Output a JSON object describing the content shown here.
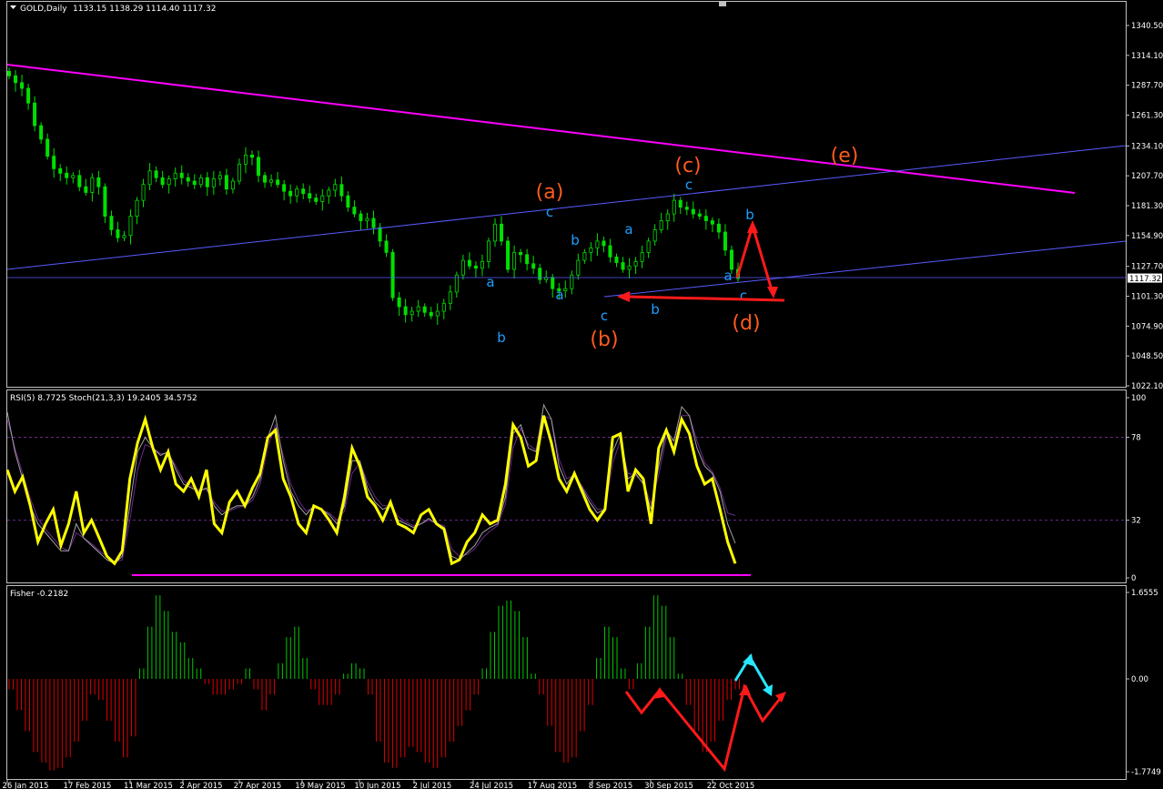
{
  "header": {
    "symbol": "GOLD,Daily",
    "ohlc": "1133.15 1138.29 1114.40 1117.32"
  },
  "colors": {
    "background": "#000000",
    "frame": "#c0c0c0",
    "candle": "#00e000",
    "magenta": "#ff00ff",
    "channel": "#5a5aff",
    "wave_blue": "#1e9fff",
    "wave_orange": "#ff5a1e",
    "arrow_red": "#ff1a1a",
    "rsi": "#ffff00",
    "stoch": "#b030b0",
    "fisher_pos": "#00c800",
    "fisher_neg": "#e00000",
    "cyan": "#28e6ff"
  },
  "price_axis": {
    "ticks": [
      "1340.50",
      "1314.10",
      "1287.70",
      "1261.30",
      "1234.10",
      "1207.70",
      "1181.30",
      "1154.90",
      "1127.70",
      "1101.30",
      "1074.90",
      "1048.50",
      "1022.10"
    ],
    "current": "1117.32"
  },
  "osc_panel": {
    "label": "RSI(5) 8.7725  Stoch(21,3,3) 19.2405 34.5752",
    "ticks": [
      "100",
      "78",
      "32",
      "0"
    ]
  },
  "fisher_panel": {
    "label": "Fisher -0.2182",
    "ticks": [
      "1.6555",
      "0.00",
      "-1.7749"
    ]
  },
  "date_axis": [
    "26 Jan 2015",
    "17 Feb 2015",
    "11 Mar 2015",
    "2 Apr 2015",
    "27 Apr 2015",
    "19 May 2015",
    "10 Jun 2015",
    "2 Jul 2015",
    "24 Jul 2015",
    "17 Aug 2015",
    "8 Sep 2015",
    "30 Sep 2015",
    "22 Oct 2015"
  ],
  "wave_labels": {
    "blue": [
      "a",
      "b",
      "c",
      "a",
      "b",
      "c",
      "a",
      "b",
      "c",
      "a",
      "b",
      "c"
    ],
    "orange": [
      "(a)",
      "(b)",
      "(c)",
      "(d)",
      "(e)"
    ]
  },
  "chart_data": [
    {
      "type": "candlestick",
      "title": "GOLD,Daily",
      "ylim": [
        1022.1,
        1352
      ],
      "close_series_approx": [
        1296,
        1290,
        1285,
        1272,
        1252,
        1240,
        1225,
        1214,
        1210,
        1206,
        1208,
        1198,
        1193,
        1206,
        1198,
        1172,
        1160,
        1153,
        1155,
        1172,
        1186,
        1200,
        1212,
        1206,
        1200,
        1205,
        1210,
        1206,
        1203,
        1200,
        1206,
        1198,
        1205,
        1208,
        1196,
        1203,
        1218,
        1226,
        1224,
        1208,
        1202,
        1204,
        1200,
        1194,
        1190,
        1196,
        1192,
        1188,
        1185,
        1190,
        1195,
        1200,
        1190,
        1180,
        1174,
        1168,
        1170,
        1162,
        1150,
        1140,
        1100,
        1092,
        1085,
        1088,
        1092,
        1087,
        1084,
        1088,
        1095,
        1105,
        1120,
        1133,
        1128,
        1126,
        1132,
        1150,
        1165,
        1150,
        1125,
        1140,
        1138,
        1130,
        1126,
        1116,
        1118,
        1108,
        1106,
        1108,
        1120,
        1133,
        1140,
        1144,
        1150,
        1146,
        1136,
        1131,
        1125,
        1128,
        1132,
        1140,
        1150,
        1160,
        1168,
        1174,
        1186,
        1180,
        1178,
        1174,
        1172,
        1168,
        1165,
        1158,
        1142,
        1125,
        1117
      ],
      "trendlines": {
        "magenta": {
          "from": [
            "26 Jan 2015",
            1308
          ],
          "to": [
            "6 Nov 2015",
            1198
          ]
        },
        "upper_channel": {
          "from": [
            "26 Jan 2015",
            1142
          ],
          "to": [
            "end",
            1235
          ]
        },
        "lower_channel": {
          "from": [
            "8 Sep 2015",
            1104
          ],
          "to": [
            "end",
            1154
          ]
        },
        "horizontal": 1117.32
      }
    },
    {
      "type": "line",
      "title": "RSI(5) 8.7725  Stoch(21,3,3) 19.2405 34.5752",
      "ylim": [
        0,
        100
      ],
      "levels": [
        78,
        32
      ],
      "series": [
        {
          "name": "RSI(5)",
          "values": [
            60,
            48,
            56,
            40,
            20,
            30,
            38,
            18,
            30,
            48,
            25,
            32,
            22,
            12,
            8,
            15,
            55,
            75,
            88,
            72,
            60,
            70,
            52,
            48,
            55,
            45,
            60,
            30,
            25,
            42,
            48,
            40,
            50,
            58,
            78,
            82,
            55,
            45,
            30,
            25,
            40,
            38,
            32,
            25,
            45,
            72,
            62,
            45,
            40,
            32,
            42,
            30,
            28,
            25,
            35,
            38,
            30,
            27,
            8,
            10,
            20,
            25,
            35,
            30,
            32,
            52,
            85,
            78,
            62,
            65,
            90,
            75,
            55,
            48,
            58,
            48,
            38,
            32,
            38,
            78,
            80,
            48,
            60,
            55,
            30,
            72,
            82,
            70,
            88,
            80,
            62,
            52,
            55,
            38,
            20,
            8
          ]
        },
        {
          "name": "Stoch %K",
          "values": [
            92,
            70,
            55,
            40,
            30,
            25,
            20,
            15,
            15,
            30,
            22,
            18,
            14,
            10,
            8,
            12,
            40,
            70,
            78,
            72,
            68,
            70,
            60,
            52,
            50,
            48,
            50,
            40,
            35,
            38,
            40,
            40,
            45,
            55,
            78,
            90,
            65,
            48,
            40,
            35,
            40,
            38,
            35,
            30,
            40,
            65,
            65,
            50,
            42,
            38,
            40,
            32,
            30,
            28,
            30,
            33,
            30,
            28,
            12,
            10,
            14,
            18,
            25,
            28,
            30,
            45,
            80,
            85,
            72,
            70,
            96,
            88,
            62,
            52,
            58,
            50,
            42,
            36,
            38,
            70,
            80,
            55,
            58,
            52,
            38,
            62,
            82,
            76,
            95,
            90,
            72,
            62,
            58,
            48,
            30,
            19.2
          ]
        },
        {
          "name": "Stoch %D",
          "values": [
            88,
            72,
            58,
            44,
            33,
            27,
            22,
            17,
            15,
            25,
            22,
            19,
            15,
            12,
            9,
            10,
            32,
            60,
            74,
            72,
            69,
            69,
            62,
            54,
            51,
            49,
            49,
            42,
            37,
            37,
            39,
            40,
            43,
            52,
            73,
            85,
            68,
            52,
            43,
            37,
            39,
            38,
            36,
            32,
            37,
            58,
            64,
            53,
            45,
            40,
            40,
            34,
            31,
            29,
            30,
            32,
            30,
            29,
            16,
            12,
            13,
            16,
            22,
            26,
            29,
            41,
            72,
            83,
            74,
            71,
            90,
            88,
            66,
            55,
            57,
            51,
            44,
            38,
            38,
            64,
            76,
            58,
            57,
            53,
            41,
            57,
            78,
            76,
            90,
            90,
            76,
            64,
            59,
            50,
            36,
            34.6
          ]
        }
      ],
      "horizontal_line": 10
    },
    {
      "type": "bar",
      "title": "Fisher -0.2182",
      "ylim": [
        -1.7749,
        1.6555
      ],
      "values": [
        -0.2,
        -0.6,
        -1.0,
        -1.4,
        -1.6,
        -1.75,
        -1.7,
        -1.5,
        -1.2,
        -0.8,
        -0.3,
        -0.4,
        -0.8,
        -1.2,
        -1.5,
        -1.1,
        0.2,
        1.0,
        1.6,
        1.3,
        0.9,
        0.7,
        0.4,
        0.2,
        -0.1,
        -0.3,
        -0.3,
        -0.2,
        -0.1,
        0.2,
        -0.2,
        -0.6,
        -0.3,
        0.3,
        0.8,
        1.0,
        0.4,
        -0.2,
        -0.5,
        -0.5,
        -0.3,
        0.1,
        0.3,
        0.2,
        -0.3,
        -1.2,
        -1.6,
        -1.7,
        -1.5,
        -1.3,
        -1.4,
        -1.6,
        -1.7,
        -1.5,
        -1.2,
        -0.9,
        -0.6,
        -0.3,
        0.2,
        0.9,
        1.4,
        1.5,
        1.3,
        0.8,
        0.1,
        -0.3,
        -0.9,
        -1.4,
        -1.6,
        -1.5,
        -1.0,
        -0.5,
        0.4,
        1.0,
        0.8,
        0.2,
        -0.2,
        0.3,
        1.0,
        1.6,
        1.4,
        0.8,
        0.1,
        -0.5,
        -1.0,
        -1.4,
        -1.2,
        -0.8,
        -0.4,
        -0.2
      ],
      "annotations": [
        "red zigzag projection",
        "cyan up/down arrows"
      ]
    }
  ]
}
